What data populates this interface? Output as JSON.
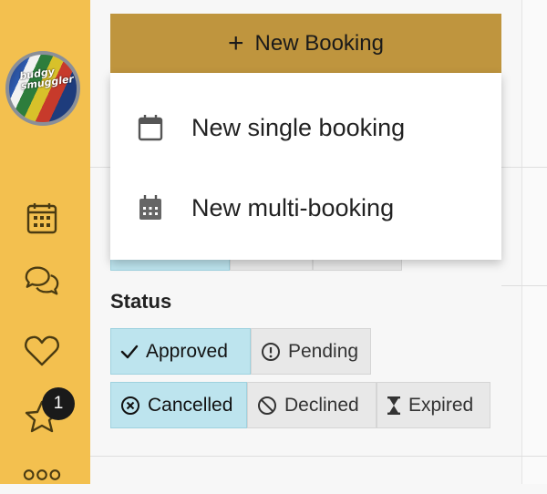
{
  "sidebar": {
    "avatar_text": "budgy smuggler",
    "items": [
      {
        "name": "calendar",
        "icon": "calendar-icon"
      },
      {
        "name": "messages",
        "icon": "chat-icon"
      },
      {
        "name": "favourites",
        "icon": "heart-icon"
      },
      {
        "name": "reviews",
        "icon": "star-icon",
        "badge": "1"
      },
      {
        "name": "more",
        "icon": "more-icon"
      }
    ],
    "color": "#f3c04f"
  },
  "new_booking": {
    "label": "New Booking",
    "color": "#bf953e",
    "menu": [
      {
        "label": "New single booking",
        "icon": "calendar-blank-icon"
      },
      {
        "label": "New multi-booking",
        "icon": "calendar-grid-icon"
      }
    ]
  },
  "status": {
    "title": "Status",
    "chips": [
      {
        "label": "Approved",
        "icon": "check-icon",
        "selected": true
      },
      {
        "label": "Pending",
        "icon": "alert-circle-icon",
        "selected": false
      },
      {
        "label": "Cancelled",
        "icon": "x-circle-icon",
        "selected": true
      },
      {
        "label": "Declined",
        "icon": "ban-icon",
        "selected": false
      },
      {
        "label": "Expired",
        "icon": "hourglass-icon",
        "selected": false
      }
    ],
    "selected_color": "#bde4ee"
  }
}
